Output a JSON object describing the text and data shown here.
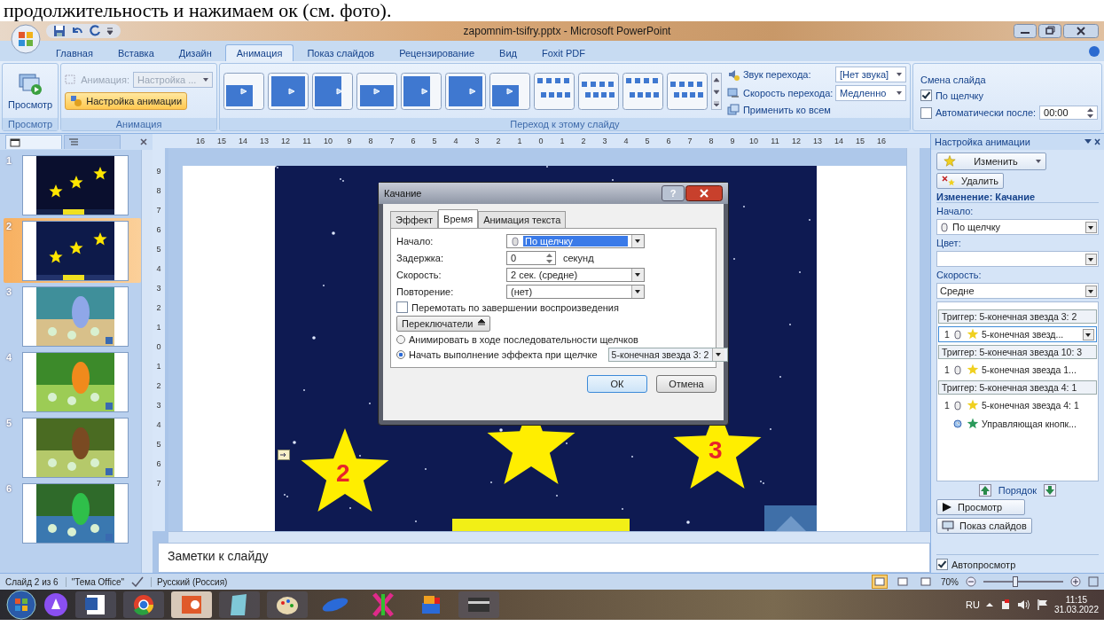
{
  "caption": "продолжительность и нажимаем ок (см. фото).",
  "window": {
    "title": "zapomnim-tsifry.pptx - Microsoft PowerPoint"
  },
  "ribbon_tabs": [
    {
      "label": "Главная",
      "selected": false
    },
    {
      "label": "Вставка",
      "selected": false
    },
    {
      "label": "Дизайн",
      "selected": false
    },
    {
      "label": "Анимация",
      "selected": true
    },
    {
      "label": "Показ слайдов",
      "selected": false
    },
    {
      "label": "Рецензирование",
      "selected": false
    },
    {
      "label": "Вид",
      "selected": false
    },
    {
      "label": "Foxit PDF",
      "selected": false
    }
  ],
  "ribbon": {
    "preview": {
      "button": "Просмотр",
      "group_label": "Просмотр"
    },
    "animation": {
      "label": "Анимация:",
      "value": "Настройка ...",
      "disabled": true,
      "custom_button": "Настройка анимации",
      "group_label": "Анимация"
    },
    "transition": {
      "sound_label": "Звук перехода:",
      "sound_value": "[Нет звука]",
      "speed_label": "Скорость перехода:",
      "speed_value": "Медленно",
      "apply_all": "Применить ко всем",
      "group_label": "Переход к этому слайду"
    },
    "advance": {
      "title": "Смена слайда",
      "on_click": {
        "label": "По щелчку",
        "checked": true
      },
      "automatic": {
        "label": "Автоматически после:",
        "checked": false,
        "value": "00:00"
      }
    }
  },
  "slides_pane": {
    "tabs": [
      {
        "selected": true
      },
      {
        "selected": false
      }
    ],
    "thumbnails": [
      {
        "number": "1",
        "selected": false
      },
      {
        "number": "2",
        "selected": true
      },
      {
        "number": "3",
        "selected": false
      },
      {
        "number": "4",
        "selected": false
      },
      {
        "number": "5",
        "selected": false
      },
      {
        "number": "6",
        "selected": false
      }
    ]
  },
  "rulers": {
    "horizontal": [
      "16",
      "15",
      "14",
      "13",
      "12",
      "11",
      "10",
      "9",
      "8",
      "7",
      "6",
      "5",
      "4",
      "3",
      "2",
      "1",
      "0",
      "1",
      "2",
      "3",
      "4",
      "5",
      "6",
      "7",
      "8",
      "9",
      "10",
      "11",
      "12",
      "13",
      "14",
      "15",
      "16"
    ],
    "vertical": [
      "9",
      "8",
      "7",
      "6",
      "5",
      "4",
      "3",
      "2",
      "1",
      "0",
      "1",
      "2",
      "3",
      "4",
      "5",
      "6",
      "7"
    ]
  },
  "slide": {
    "stars": [
      {
        "number": "2"
      },
      {
        "number": "3"
      }
    ]
  },
  "dialog": {
    "title": "Качание",
    "help_button": "?",
    "tabs": [
      {
        "label": "Эффект",
        "selected": false
      },
      {
        "label": "Время",
        "selected": true
      },
      {
        "label": "Анимация текста",
        "selected": false
      }
    ],
    "start": {
      "label": "Начало:",
      "value": "По щелчку"
    },
    "delay": {
      "label": "Задержка:",
      "value": "0",
      "unit": "секунд"
    },
    "speed": {
      "label": "Скорость:",
      "value": "2 сек. (средне)"
    },
    "repeat": {
      "label": "Повторение:",
      "value": "(нет)"
    },
    "rewind": {
      "label": "Перемотать по завершении воспроизведения",
      "checked": false
    },
    "triggers_button": "Переключатели",
    "trigger_options": [
      {
        "label": "Анимировать в ходе последовательности щелчков",
        "selected": false
      },
      {
        "label": "Начать выполнение эффекта при щелчке",
        "selected": true,
        "value": "5-конечная звезда 3: 2"
      }
    ],
    "buttons": [
      {
        "label": "ОК",
        "default": true
      },
      {
        "label": "Отмена",
        "default": false
      }
    ]
  },
  "notes": {
    "text": "Заметки к слайду"
  },
  "task_pane": {
    "title": "Настройка анимации",
    "change_button": "Изменить",
    "remove_button": "Удалить",
    "heading": "Изменение: Качание",
    "start": {
      "label": "Начало:",
      "value": "По щелчку"
    },
    "color": {
      "label": "Цвет:"
    },
    "speed": {
      "label": "Скорость:",
      "value": "Средне"
    },
    "groups": [
      {
        "trigger": "Триггер: 5-конечная звезда 3: 2",
        "items": [
          {
            "order": "1",
            "kind": "click",
            "label": "5-конечная звезд...",
            "selected": true
          }
        ]
      },
      {
        "trigger": "Триггер: 5-конечная звезда 10: 3",
        "items": [
          {
            "order": "1",
            "kind": "click",
            "label": "5-конечная звезда 1...",
            "selected": false
          }
        ]
      },
      {
        "trigger": "Триггер: 5-конечная звезда 4: 1",
        "items": [
          {
            "order": "1",
            "kind": "click",
            "label": "5-конечная звезда 4: 1",
            "selected": false
          },
          {
            "kind": "after",
            "label": "Управляющая кнопк...",
            "selected": false
          }
        ]
      }
    ],
    "order_label": "Порядок",
    "play_button": "Просмотр",
    "slideshow_button": "Показ слайдов",
    "autopreview": {
      "label": "Автопросмотр",
      "checked": true
    }
  },
  "status_bar": {
    "slide": "Слайд 2 из 6",
    "theme": "\"Тема Office\"",
    "language": "Русский (Россия)",
    "views": [
      {
        "selected": true
      },
      {
        "selected": false
      },
      {
        "selected": false
      }
    ],
    "zoom": "70%",
    "zoom_slider": {
      "level": 0.4
    }
  },
  "taskbar": {
    "language": "RU",
    "time": "11:15",
    "date": "31.03.2022"
  }
}
